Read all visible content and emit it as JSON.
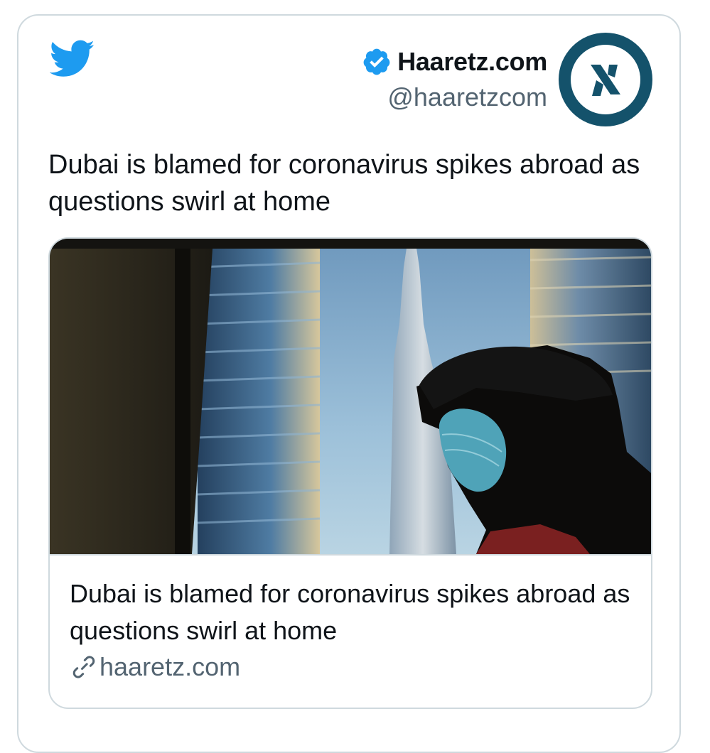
{
  "tweet": {
    "author_name": "Haaretz.com",
    "author_handle": "@haaretzcom",
    "text": "Dubai is blamed for coronavirus spikes abroad as questions swirl at home"
  },
  "link_card": {
    "title": "Dubai is blamed for coronavirus spikes abroad as questions swirl at home",
    "domain": "haaretz.com"
  },
  "colors": {
    "twitter_blue": "#1d9bf0",
    "avatar_teal": "#14526b",
    "text_primary": "#0f1419",
    "text_secondary": "#536471",
    "border": "#cfd9de"
  },
  "icons": [
    "twitter-bird-icon",
    "verified-badge-icon",
    "link-icon"
  ]
}
